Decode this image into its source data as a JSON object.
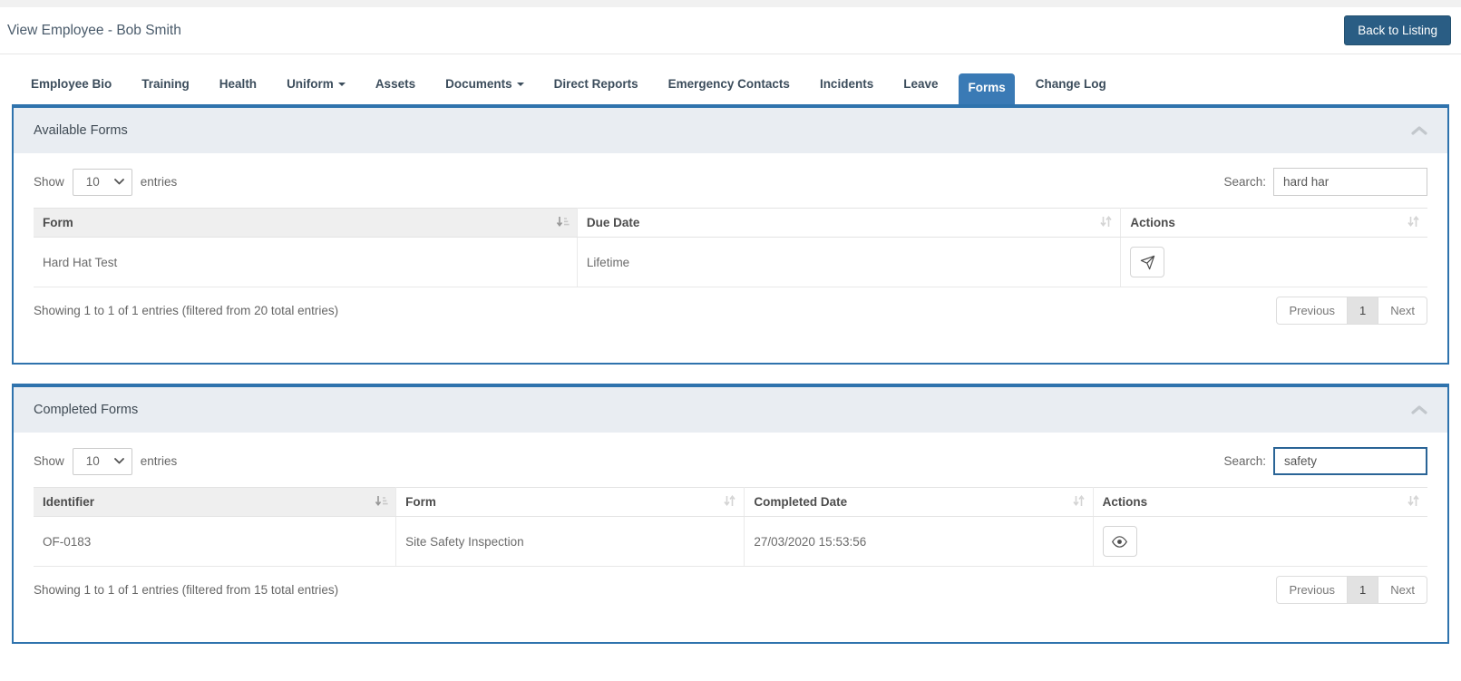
{
  "page": {
    "title": "View Employee - Bob Smith",
    "back_button_label": "Back to Listing"
  },
  "tabs": [
    {
      "label": "Employee Bio"
    },
    {
      "label": "Training"
    },
    {
      "label": "Health"
    },
    {
      "label": "Uniform",
      "has_dropdown": true
    },
    {
      "label": "Assets"
    },
    {
      "label": "Documents",
      "has_dropdown": true
    },
    {
      "label": "Direct Reports"
    },
    {
      "label": "Emergency Contacts"
    },
    {
      "label": "Incidents"
    },
    {
      "label": "Leave"
    },
    {
      "label": "Forms",
      "active": true
    },
    {
      "label": "Change Log"
    }
  ],
  "panels": [
    {
      "title": "Available Forms",
      "length": {
        "show_label": "Show",
        "value": "10",
        "entries_label": "entries"
      },
      "search": {
        "label": "Search:",
        "value": "hard har"
      },
      "table": {
        "columns": [
          "Form",
          "Due Date",
          "Actions"
        ],
        "sorted_column": "Form",
        "rows": [
          {
            "cells": [
              "Hard Hat Test",
              "Lifetime"
            ],
            "action": "send"
          }
        ]
      },
      "summary": "Showing 1 to 1 of 1 entries (filtered from 20 total entries)",
      "pagination": {
        "previous_label": "Previous",
        "current_page": "1",
        "next_label": "Next"
      }
    },
    {
      "title": "Completed Forms",
      "length": {
        "show_label": "Show",
        "value": "10",
        "entries_label": "entries"
      },
      "search": {
        "label": "Search:",
        "value": "safety",
        "focused": true
      },
      "table": {
        "columns": [
          "Identifier",
          "Form",
          "Completed Date",
          "Actions"
        ],
        "sorted_column": "Identifier",
        "rows": [
          {
            "cells": [
              "OF-0183",
              "Site Safety Inspection",
              "27/03/2020 15:53:56"
            ],
            "action": "view"
          }
        ]
      },
      "summary": "Showing 1 to 1 of 1 entries (filtered from 15 total entries)",
      "pagination": {
        "previous_label": "Previous",
        "current_page": "1",
        "next_label": "Next"
      }
    }
  ],
  "colors": {
    "accent_blue": "#3a7ab5",
    "panel_border": "#2f73ad",
    "back_button": "#2a5d84",
    "panel_header_bg": "#e9edf2",
    "focused_input_border": "#2a6496"
  }
}
